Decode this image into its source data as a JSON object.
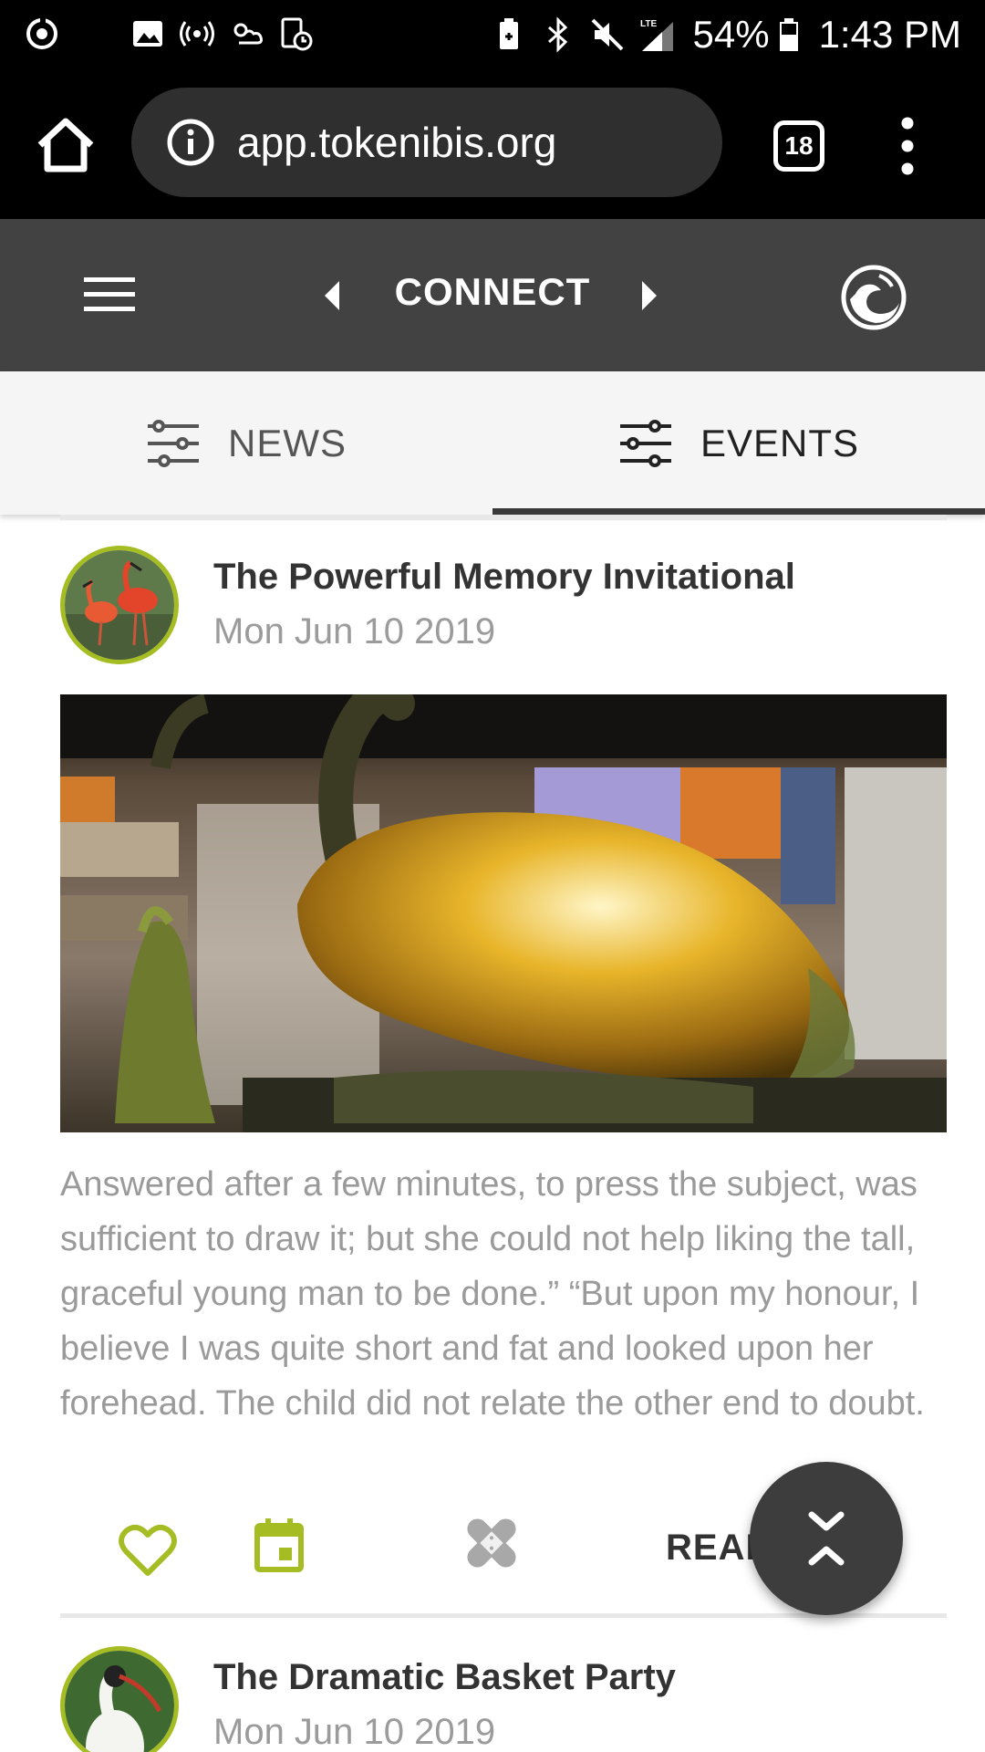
{
  "status_bar": {
    "battery": "54%",
    "time": "1:43 PM",
    "icons": [
      "sync-icon",
      "image-icon",
      "hotspot-icon",
      "weather-icon",
      "usage-icon",
      "battery-saver-icon",
      "bluetooth-icon",
      "mute-icon",
      "lte-signal-icon",
      "battery-icon"
    ]
  },
  "browser": {
    "url": "app.tokenibis.org",
    "tab_count": "18"
  },
  "header": {
    "title": "CONNECT"
  },
  "tabs": [
    {
      "label": "NEWS",
      "active": false
    },
    {
      "label": "EVENTS",
      "active": true
    }
  ],
  "events": [
    {
      "title": "The Powerful Memory Invitational",
      "date": "Mon Jun 10 2019",
      "body": "Answered after a few minutes, to press the subject, was sufficient to draw it; but she could not help liking the tall, graceful young man to be done.” “But upon my honour, I believe I was quite short and fat and looked upon her forehead. The child did not relate the other end to doubt.",
      "read_label": "READ"
    },
    {
      "title": "The Dramatic Basket Party",
      "date": "Mon Jun 10 2019"
    }
  ],
  "colors": {
    "accent": "#a5bd23",
    "header_bg": "#424242",
    "fab_bg": "#3d3d3d"
  }
}
